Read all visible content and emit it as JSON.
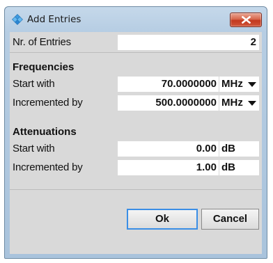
{
  "window": {
    "title": "Add Entries",
    "title_icon": "add-entries-icon",
    "close_icon": "close-icon"
  },
  "nr_of_entries": {
    "label": "Nr. of Entries",
    "value": "2"
  },
  "frequencies": {
    "title": "Frequencies",
    "start_with": {
      "label": "Start with",
      "value": "70.0000000",
      "unit": "MHz"
    },
    "incremented_by": {
      "label": "Incremented by",
      "value": "500.0000000",
      "unit": "MHz"
    }
  },
  "attenuations": {
    "title": "Attenuations",
    "start_with": {
      "label": "Start with",
      "value": "0.00",
      "unit": "dB"
    },
    "incremented_by": {
      "label": "Incremented by",
      "value": "1.00",
      "unit": "dB"
    }
  },
  "buttons": {
    "ok": "Ok",
    "cancel": "Cancel"
  },
  "colors": {
    "title_bar": "#b6cde3",
    "close_button": "#c2381e",
    "panel_background": "#d9d9d9",
    "focus_border": "#3a8ee6"
  }
}
